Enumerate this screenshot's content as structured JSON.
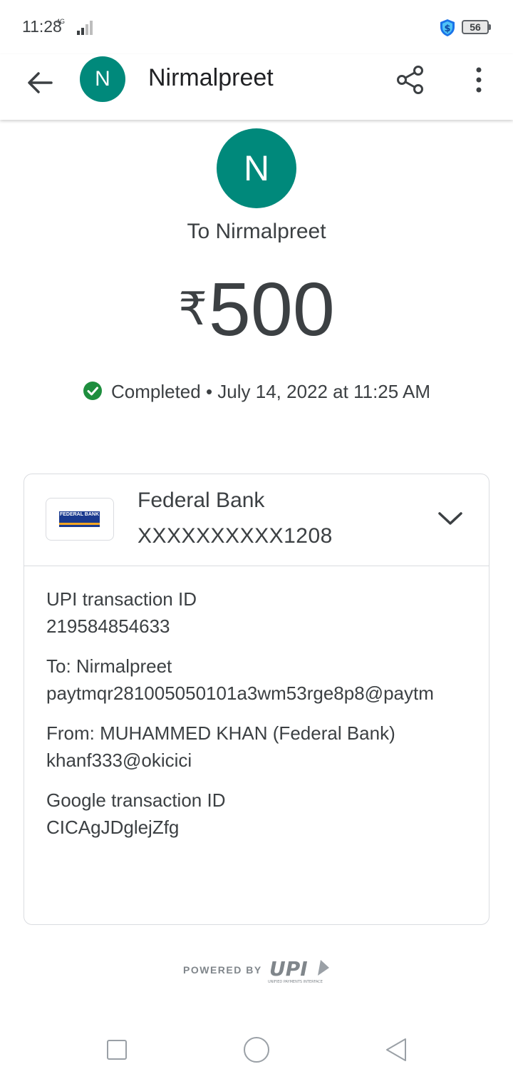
{
  "status_bar": {
    "time": "11:28",
    "network": "4G",
    "battery": "56"
  },
  "app_bar": {
    "avatar_letter": "N",
    "title": "Nirmalpreet"
  },
  "header": {
    "avatar_letter": "N",
    "to_label": "To Nirmalpreet",
    "currency_symbol": "₹",
    "amount": "500",
    "status": "Completed",
    "separator": " • ",
    "date": "July 14, 2022 at 11:25 AM"
  },
  "bank": {
    "name": "Federal Bank",
    "account": "XXXXXXXXXX1208",
    "logo_text": "FEDERAL BANK"
  },
  "details": [
    {
      "label": "UPI transaction ID",
      "value": "219584854633"
    },
    {
      "label": "To: Nirmalpreet",
      "value": "paytmqr281005050101a3wm53rge8p8@paytm"
    },
    {
      "label": "From: MUHAMMED KHAN (Federal Bank)",
      "value": "khanf333@okicici"
    },
    {
      "label": "Google transaction ID",
      "value": "CICAgJDglejZfg"
    }
  ],
  "footer": {
    "powered_by": "POWERED BY",
    "upi_logo": "UPI",
    "upi_subtext": "UNIFIED PAYMENTS INTERFACE"
  },
  "colors": {
    "avatar": "#00897b",
    "success": "#1e8e3e",
    "text": "#3c4043",
    "border": "#dadce0"
  }
}
